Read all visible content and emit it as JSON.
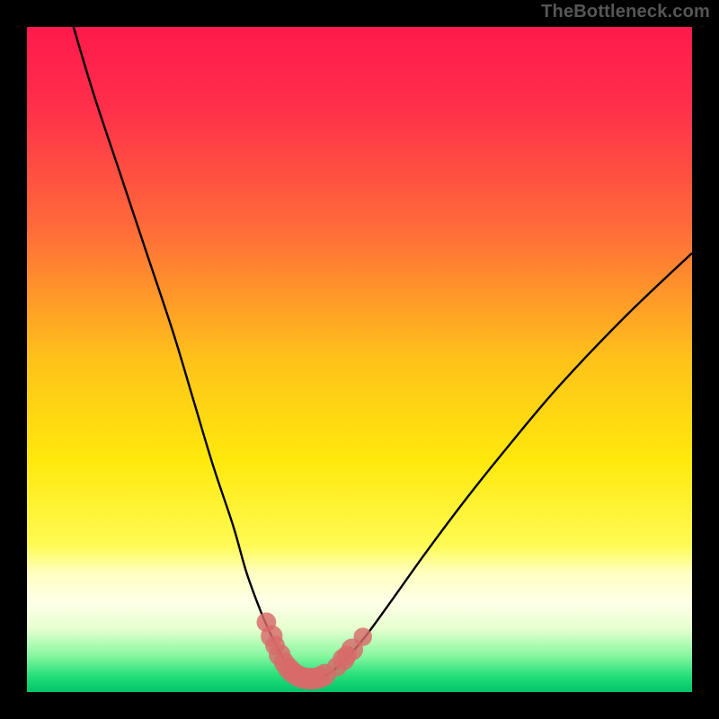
{
  "watermark": "TheBottleneck.com",
  "colors": {
    "bg": "#000000",
    "gradient_stops": [
      {
        "offset": 0.0,
        "color": "#ff1a4d"
      },
      {
        "offset": 0.12,
        "color": "#ff2f4a"
      },
      {
        "offset": 0.3,
        "color": "#ff6a3a"
      },
      {
        "offset": 0.5,
        "color": "#ffc21a"
      },
      {
        "offset": 0.65,
        "color": "#ffe80c"
      },
      {
        "offset": 0.78,
        "color": "#fffb55"
      },
      {
        "offset": 0.82,
        "color": "#ffffc0"
      },
      {
        "offset": 0.865,
        "color": "#ffffe8"
      },
      {
        "offset": 0.905,
        "color": "#e6ffd0"
      },
      {
        "offset": 0.945,
        "color": "#88f7a0"
      },
      {
        "offset": 0.975,
        "color": "#26e07a"
      },
      {
        "offset": 1.0,
        "color": "#00c46a"
      }
    ],
    "curve": "#000000",
    "marker_fill": "#d86a6a",
    "marker_stroke": "#b74f4f"
  },
  "chart_data": {
    "type": "line",
    "title": "",
    "xlabel": "",
    "ylabel": "",
    "xlim": [
      0,
      100
    ],
    "ylim": [
      0,
      100
    ],
    "grid": false,
    "series": [
      {
        "name": "bottleneck-curve",
        "x": [
          7,
          10,
          14,
          18,
          22,
          25,
          28,
          31,
          33,
          35,
          36.5,
          38,
          39,
          40,
          41,
          42,
          43,
          44.5,
          46,
          48,
          51,
          55,
          60,
          66,
          72,
          80,
          90,
          100
        ],
        "y": [
          100,
          90,
          78,
          66,
          54,
          44,
          34,
          25,
          18,
          12.5,
          9,
          6,
          4.2,
          3,
          2.3,
          2,
          2,
          2.3,
          3.2,
          5,
          8.5,
          14,
          21,
          29,
          36.5,
          46,
          56.5,
          66
        ]
      }
    ],
    "markers": {
      "name": "highlight-dots",
      "points": [
        {
          "x": 36.0,
          "y": 10.5,
          "r": 1.7
        },
        {
          "x": 36.8,
          "y": 8.4,
          "r": 1.9
        },
        {
          "x": 37.3,
          "y": 7.0,
          "r": 1.7
        },
        {
          "x": 38.0,
          "y": 5.6,
          "r": 1.9
        },
        {
          "x": 38.7,
          "y": 4.4,
          "r": 1.8
        },
        {
          "x": 39.3,
          "y": 3.6,
          "r": 1.9
        },
        {
          "x": 40.0,
          "y": 2.9,
          "r": 1.9
        },
        {
          "x": 40.8,
          "y": 2.4,
          "r": 1.9
        },
        {
          "x": 41.6,
          "y": 2.1,
          "r": 1.9
        },
        {
          "x": 42.4,
          "y": 2.0,
          "r": 1.9
        },
        {
          "x": 43.2,
          "y": 2.0,
          "r": 1.9
        },
        {
          "x": 44.0,
          "y": 2.2,
          "r": 1.9
        },
        {
          "x": 44.8,
          "y": 2.6,
          "r": 1.9
        },
        {
          "x": 46.6,
          "y": 3.8,
          "r": 1.7
        },
        {
          "x": 47.6,
          "y": 4.9,
          "r": 1.9
        },
        {
          "x": 48.1,
          "y": 5.5,
          "r": 1.7
        },
        {
          "x": 48.9,
          "y": 6.4,
          "r": 1.9
        },
        {
          "x": 50.5,
          "y": 8.3,
          "r": 1.6
        }
      ]
    }
  }
}
